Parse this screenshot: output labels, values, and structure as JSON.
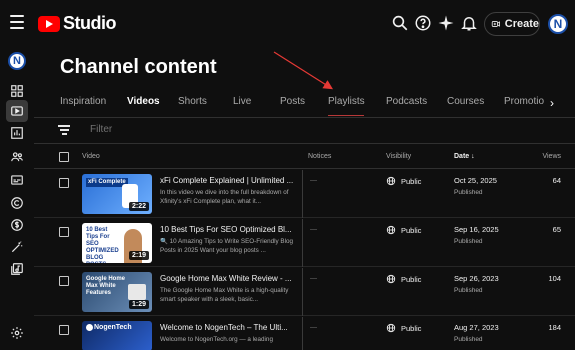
{
  "app": {
    "logo_text": "Studio"
  },
  "header": {
    "create_label": "Create",
    "avatar_letter": "N"
  },
  "sidebar": {
    "avatar_letter": "N",
    "items": [
      {
        "icon": "dashboard-icon"
      },
      {
        "icon": "content-icon",
        "active": true
      },
      {
        "icon": "analytics-icon"
      },
      {
        "icon": "community-icon"
      },
      {
        "icon": "subtitles-icon"
      },
      {
        "icon": "copyright-icon"
      },
      {
        "icon": "earn-icon"
      },
      {
        "icon": "customization-icon"
      },
      {
        "icon": "audio-library-icon"
      }
    ],
    "settings_icon": "gear-icon"
  },
  "page": {
    "title": "Channel content"
  },
  "tabs": [
    {
      "label": "Inspiration"
    },
    {
      "label": "Videos",
      "active": true
    },
    {
      "label": "Shorts"
    },
    {
      "label": "Live"
    },
    {
      "label": "Posts"
    },
    {
      "label": "Playlists"
    },
    {
      "label": "Podcasts"
    },
    {
      "label": "Courses"
    },
    {
      "label": "Promotio"
    }
  ],
  "filter": {
    "placeholder": "Filter"
  },
  "table": {
    "headers": {
      "video": "Video",
      "notices": "Notices",
      "visibility": "Visibility",
      "date": "Date ↓",
      "views": "Views"
    },
    "rows": [
      {
        "title": "xFi Complete Explained | Unlimited ...",
        "description": "In this video we dive into the full breakdown of Xfinity's xFi Complete plan, what it...",
        "duration": "2:22",
        "thumb_text": "xFi Complete",
        "thumb_bg": "#2a6fd6",
        "notices": "—",
        "visibility": "Public",
        "date": "Oct 25, 2025",
        "status": "Published",
        "views": "64"
      },
      {
        "title": "10 Best Tips For SEO Optimized Bl...",
        "description": "🔍 10 Amazing Tips to Write SEO-Friendly Blog Posts in 2025 Want your blog posts ...",
        "duration": "2:19",
        "thumb_text": "10 Best Tips For SEO OPTIMIZED BLOG POSTS",
        "thumb_bg": "#ffffff",
        "notices": "—",
        "visibility": "Public",
        "date": "Sep 16, 2025",
        "status": "Published",
        "views": "65"
      },
      {
        "title": "Google Home Max White Review - ...",
        "description": "The Google Home Max White is a high-quality smart speaker with a sleek, basic...",
        "duration": "1:29",
        "thumb_text": "Google Home Max White Features",
        "thumb_bg": "#3a5a80",
        "notices": "—",
        "visibility": "Public",
        "date": "Sep 26, 2023",
        "status": "Published",
        "views": "104"
      },
      {
        "title": "Welcome to NogenTech – The Ulti...",
        "description": "Welcome to NogenTech.org — a leading",
        "duration": "",
        "thumb_text": "NogenTech",
        "thumb_bg": "#1d3f8a",
        "notices": "—",
        "visibility": "Public",
        "date": "Aug 27, 2023",
        "status": "Published",
        "views": "184"
      }
    ]
  },
  "colors": {
    "accent_red": "#ff0000",
    "bg": "#0f0f0f",
    "annotation_arrow": "#e53935"
  }
}
